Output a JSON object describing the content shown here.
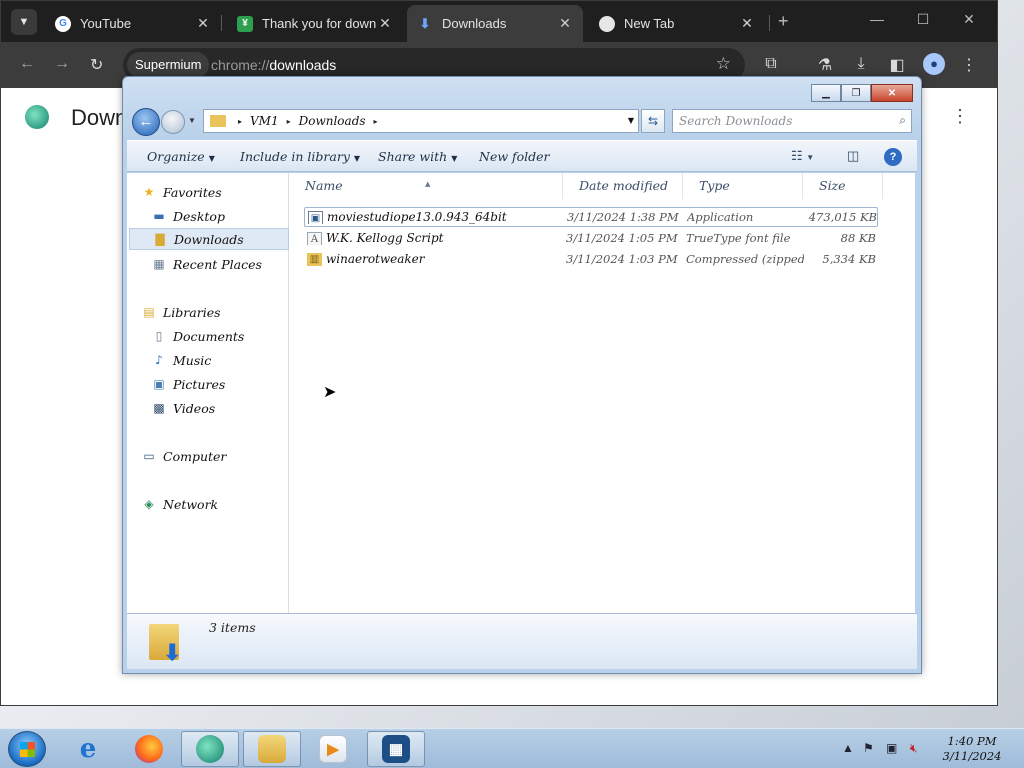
{
  "browser": {
    "tabs": [
      {
        "title": "YouTube",
        "favicon": "google-g-icon"
      },
      {
        "title": "Thank you for downloading",
        "favicon": "download-site-icon"
      },
      {
        "title": "Downloads",
        "favicon": "download-arrow-icon",
        "active": true
      },
      {
        "title": "New Tab",
        "favicon": "new-tab-icon"
      }
    ],
    "omnibox": {
      "chip": "Supermium",
      "url_scheme": "chrome://",
      "url_path": "downloads"
    },
    "page_title": "Downl"
  },
  "explorer": {
    "breadcrumb": [
      "VM1",
      "Downloads"
    ],
    "search_placeholder": "Search Downloads",
    "commands": {
      "organize": "Organize",
      "include_in_library": "Include in library",
      "share_with": "Share with",
      "new_folder": "New folder"
    },
    "nav": {
      "favorites": "Favorites",
      "desktop": "Desktop",
      "downloads": "Downloads",
      "recent_places": "Recent Places",
      "libraries": "Libraries",
      "documents": "Documents",
      "music": "Music",
      "pictures": "Pictures",
      "videos": "Videos",
      "computer": "Computer",
      "network": "Network"
    },
    "columns": {
      "name": "Name",
      "date_modified": "Date modified",
      "type": "Type",
      "size": "Size"
    },
    "files": [
      {
        "name": "moviestudiope13.0.943_64bit",
        "date": "3/11/2024 1:38 PM",
        "type": "Application",
        "size": "473,015 KB",
        "icon": "application-icon"
      },
      {
        "name": "W.K. Kellogg Script",
        "date": "3/11/2024 1:05 PM",
        "type": "TrueType font file",
        "size": "88 KB",
        "icon": "font-file-icon"
      },
      {
        "name": "winaerotweaker",
        "date": "3/11/2024 1:03 PM",
        "type": "Compressed (zipped) Folder",
        "size": "5,334 KB",
        "icon": "zip-folder-icon"
      }
    ],
    "item_count": "3 items"
  },
  "taskbar": {
    "time": "1:40 PM",
    "date": "3/11/2024"
  }
}
